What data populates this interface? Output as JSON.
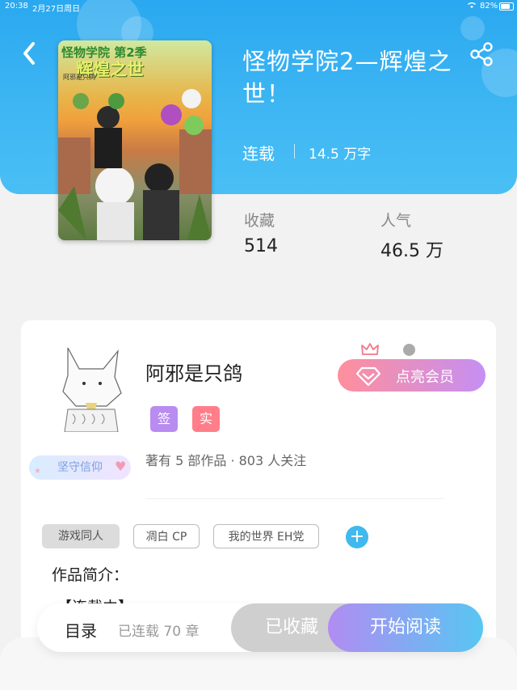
{
  "status_bar": {
    "time": "20:38",
    "date": "2月27日周日",
    "battery": "82%",
    "battery_level": 0.82
  },
  "header": {
    "back_icon": "chevron-left-icon",
    "share_icon": "share-icon"
  },
  "book": {
    "cover_title_line1": "怪物学院 第2季",
    "cover_title_line2": "辉煌之世",
    "cover_author": "阿邪是只鸽",
    "title": "怪物学院2—辉煌之世！",
    "status": "连载",
    "word_count": "14.5 万字",
    "stats": [
      {
        "label": "收藏",
        "value": "514"
      },
      {
        "label": "人气",
        "value": "46.5 万"
      }
    ]
  },
  "author": {
    "name": "阿邪是只鸽",
    "badge": "坚守信仰",
    "tag_sign": "签",
    "tag_real": "实",
    "meta": "著有 5 部作品 · 803 人关注",
    "vip_button": "点亮会员"
  },
  "tags": [
    "游戏同人",
    "凋白 CP",
    "我的世界 EH党"
  ],
  "intro": {
    "title": "作品简介：",
    "text": "【连载中】"
  },
  "bottom_bar": {
    "toc_label": "目录",
    "toc_count": "已连载 70 章",
    "collected_label": "已收藏",
    "read_label": "开始阅读"
  },
  "colors": {
    "hero_blue": "#2aa8f0",
    "vip_gradient_start": "#ff8f9b",
    "vip_gradient_end": "#c58ff3",
    "read_gradient_start": "#b18cf2",
    "read_gradient_end": "#57c6f2",
    "add_button": "#3fb9ee"
  }
}
